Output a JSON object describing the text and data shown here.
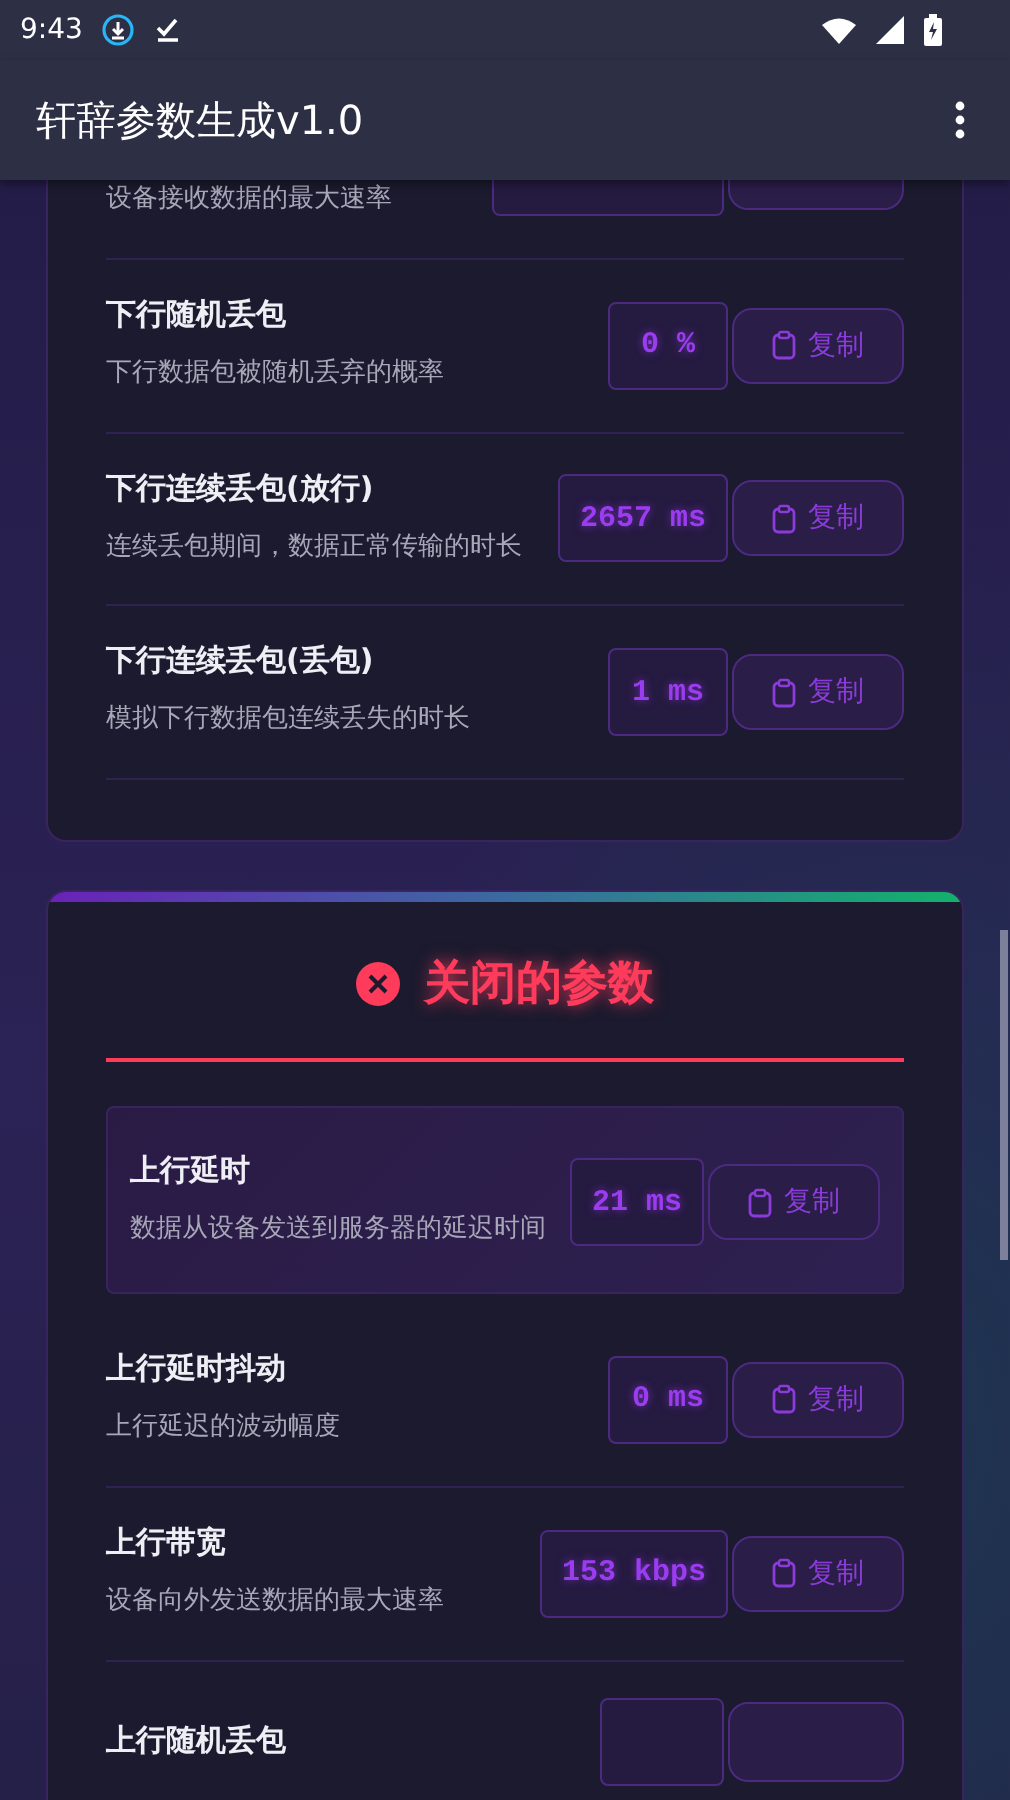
{
  "status_bar": {
    "time": "9:43"
  },
  "app_bar": {
    "title": "轩辞参数生成v1.0"
  },
  "sections": [
    {
      "rows": [
        {
          "kind": "partial",
          "description": "设备接收数据的最大速率"
        },
        {
          "kind": "param",
          "title": "下行随机丢包",
          "description": "下行数据包被随机丢弃的概率",
          "value": "0 %",
          "button": "复制",
          "highlighted": false
        },
        {
          "kind": "param",
          "title": "下行连续丢包(放行)",
          "description": "连续丢包期间，数据正常传输的时长",
          "value": "2657 ms",
          "button": "复制",
          "highlighted": false
        },
        {
          "kind": "param",
          "title": "下行连续丢包(丢包)",
          "description": "模拟下行数据包连续丢失的时长",
          "value": "1 ms",
          "button": "复制",
          "highlighted": false
        }
      ]
    },
    {
      "header": {
        "title": "关闭的参数"
      },
      "rows": [
        {
          "kind": "param",
          "title": "上行延时",
          "description": "数据从设备发送到服务器的延迟时间",
          "value": "21 ms",
          "button": "复制",
          "highlighted": true
        },
        {
          "kind": "param",
          "title": "上行延时抖动",
          "description": "上行延迟的波动幅度",
          "value": "0 ms",
          "button": "复制",
          "highlighted": false
        },
        {
          "kind": "param",
          "title": "上行带宽",
          "description": "设备向外发送数据的最大速率",
          "value": "153 kbps",
          "button": "复制",
          "highlighted": false
        },
        {
          "kind": "tail",
          "title": "上行随机丢包"
        }
      ]
    }
  ]
}
